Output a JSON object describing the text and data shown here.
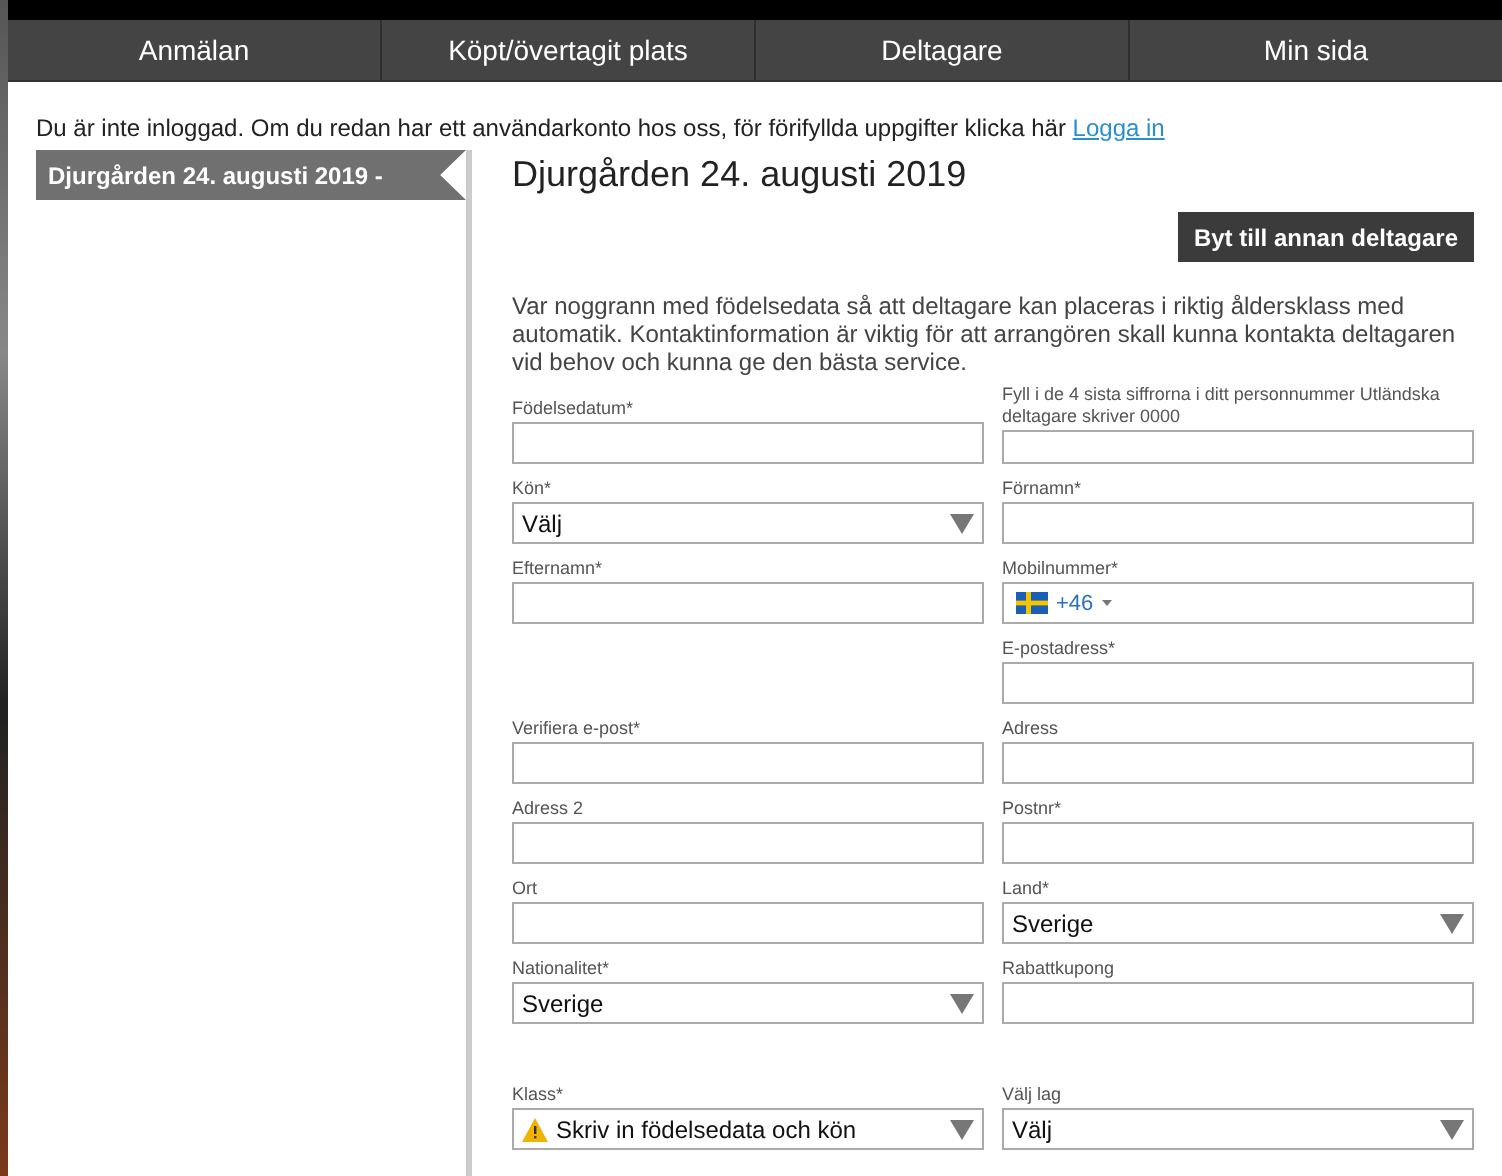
{
  "nav": [
    {
      "label": "Anmälan"
    },
    {
      "label": "Köpt/övertagit plats"
    },
    {
      "label": "Deltagare"
    },
    {
      "label": "Min sida"
    }
  ],
  "notice": {
    "text": "Du är inte inloggad. Om du redan har ett användarkonto hos oss, för förifyllda uppgifter klicka här",
    "link": "Logga in"
  },
  "sidebar": {
    "items": [
      {
        "label": "Djurgården 24. augusti 2019 -",
        "selected": true
      }
    ]
  },
  "title": "Djurgården 24. augusti 2019",
  "switch_button": "Byt till annan deltagare",
  "intro": "Var noggrann med födelsedata så att deltagare kan placeras i riktig åldersklass med automatik. Kontaktinformation är viktig för att arrangören skall kunna kontakta deltagaren vid behov och kunna ge den bästa service.",
  "rows": [
    {
      "left": {
        "kind": "text",
        "label": "Födelsedatum*"
      },
      "right": {
        "kind": "text",
        "label": "Fyll i de 4 sista siffrorna i ditt personnummer Utländska deltagare skriver 0000"
      }
    },
    {
      "left": {
        "kind": "select",
        "label": "Kön*",
        "value": "Välj"
      },
      "right": {
        "kind": "text",
        "label": "Förnamn*"
      }
    },
    {
      "left": {
        "kind": "text",
        "label": "Efternamn*"
      },
      "right": {
        "kind": "phone",
        "label": "Mobilnummer*",
        "value": "+46"
      }
    },
    {
      "right": {
        "kind": "text",
        "label": "E-postadress*"
      }
    },
    {
      "left": {
        "kind": "text",
        "label": "Verifiera e-post*"
      },
      "right": {
        "kind": "text",
        "label": "Adress"
      }
    },
    {
      "left": {
        "kind": "text",
        "label": "Adress 2"
      },
      "right": {
        "kind": "text",
        "label": "Postnr*"
      }
    },
    {
      "left": {
        "kind": "text",
        "label": "Ort"
      },
      "right": {
        "kind": "select",
        "label": "Land*",
        "value": "Sverige"
      }
    },
    {
      "left": {
        "kind": "select",
        "label": "Nationalitet*",
        "value": "Sverige"
      },
      "right": {
        "kind": "text",
        "label": "Rabattkupong"
      }
    },
    {
      "gap": true,
      "left": {
        "kind": "warning",
        "label": "Klass*",
        "value": "Skriv in födelsedata och kön"
      },
      "right": {
        "kind": "select",
        "label": "Välj lag",
        "value": "Välj"
      }
    }
  ]
}
